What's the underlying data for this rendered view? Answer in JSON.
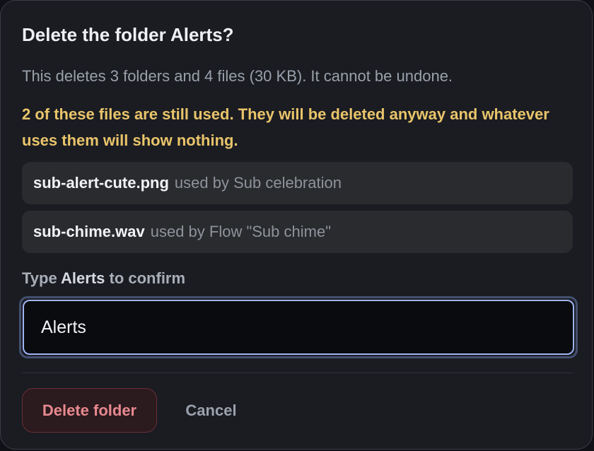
{
  "dialog": {
    "title": "Delete the folder Alerts?",
    "description": "This deletes 3 folders and 4 files (30 KB). It cannot be undone.",
    "warning": "2 of these files are still used. They will be deleted anyway and whatever uses them will show nothing.",
    "usages": [
      {
        "file": "sub-alert-cute.png",
        "used_by": "used by Sub celebration"
      },
      {
        "file": "sub-chime.wav",
        "used_by": "used by Flow \"Sub chime\""
      }
    ],
    "confirm": {
      "prefix": "Type",
      "folder_name": "Alerts",
      "suffix": "to confirm",
      "value": "Alerts"
    },
    "buttons": {
      "delete_label": "Delete folder",
      "cancel_label": "Cancel"
    }
  },
  "colors": {
    "warning": "#e9c46a",
    "danger": "#e8898f",
    "focus_ring": "#9fb4f5",
    "background": "#1a1c22"
  }
}
